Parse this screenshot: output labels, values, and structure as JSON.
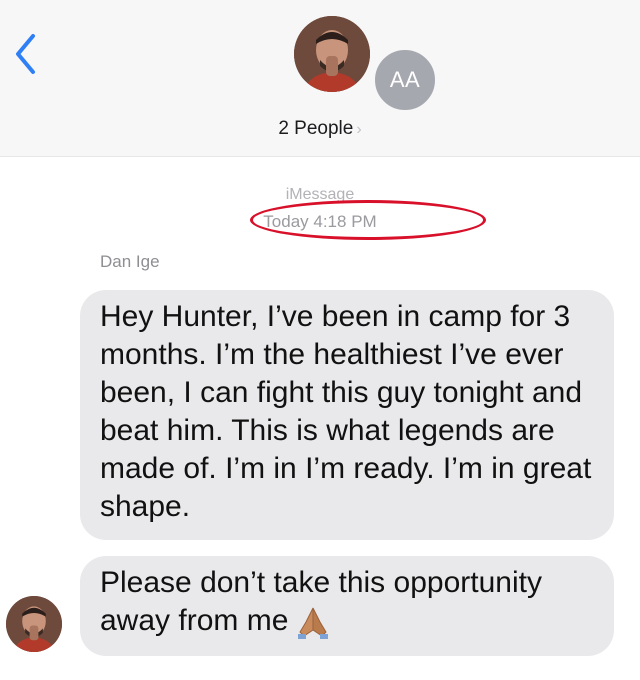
{
  "header": {
    "group_label": "2 People",
    "chevron": "›",
    "aa_initials": "AA",
    "back_icon": "chevron-left-icon",
    "accent_color": "#2f7ff5"
  },
  "conversation": {
    "service_label": "iMessage",
    "timestamp": "Today 4:18 PM",
    "sender_name": "Dan Ige",
    "messages": [
      {
        "text": "Hey Hunter, I’ve been in camp for 3 months. I’m the healthiest I’ve ever been, I can fight this guy tonight and beat him. This is what legends are made of. I’m in I’m ready. I’m in great shape."
      },
      {
        "text": "Please don’t take this opportunity away from me",
        "emoji": "folded-hands-icon"
      }
    ]
  },
  "annotation": {
    "color": "#d8102a"
  }
}
